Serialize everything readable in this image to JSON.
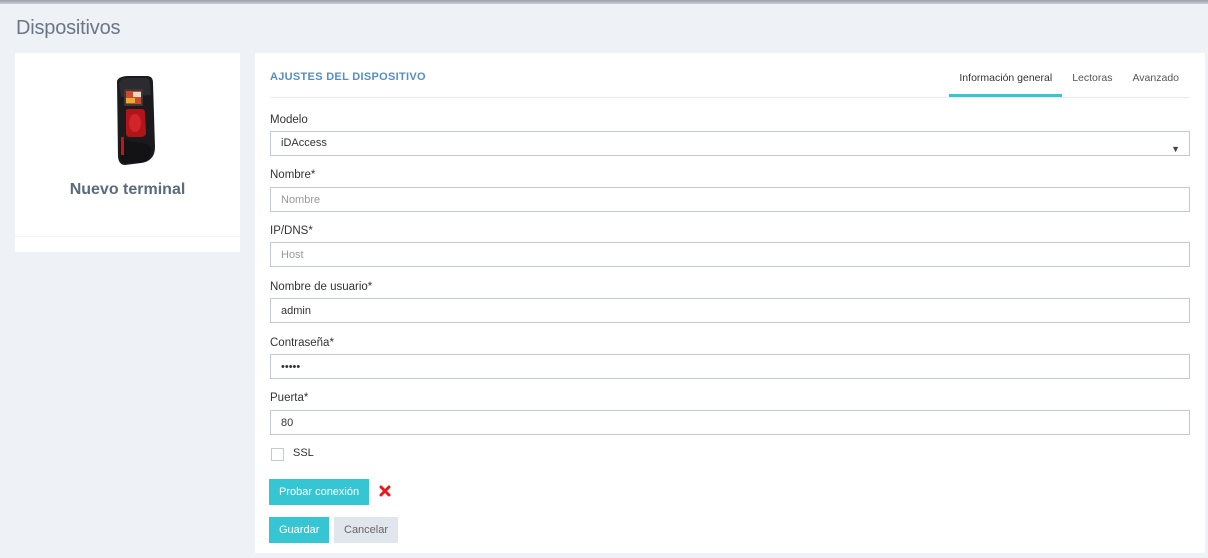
{
  "page": {
    "title": "Dispositivos"
  },
  "device_card": {
    "name": "Nuevo terminal"
  },
  "settings": {
    "section_title": "AJUSTES DEL DISPOSITIVO",
    "tabs": [
      {
        "label": "Información general",
        "active": true
      },
      {
        "label": "Lectoras",
        "active": false
      },
      {
        "label": "Avanzado",
        "active": false
      }
    ],
    "fields": {
      "model": {
        "label": "Modelo",
        "value": "iDAccess"
      },
      "name": {
        "label": "Nombre*",
        "value": "",
        "placeholder": "Nombre"
      },
      "host": {
        "label": "IP/DNS*",
        "value": "",
        "placeholder": "Host"
      },
      "username": {
        "label": "Nombre de usuario*",
        "value": "admin"
      },
      "password": {
        "label": "Contraseña*",
        "value": "admin"
      },
      "port": {
        "label": "Puerta*",
        "value": "80"
      },
      "ssl": {
        "label": "SSL",
        "checked": false
      }
    },
    "test_button": "Probar conexión",
    "test_status_icon": "error-x-icon",
    "save_button": "Guardar",
    "cancel_button": "Cancelar"
  },
  "colors": {
    "accent": "#36c6d3",
    "section_title": "#578ebe",
    "error": "#e7191f",
    "background": "#eef1f5"
  }
}
